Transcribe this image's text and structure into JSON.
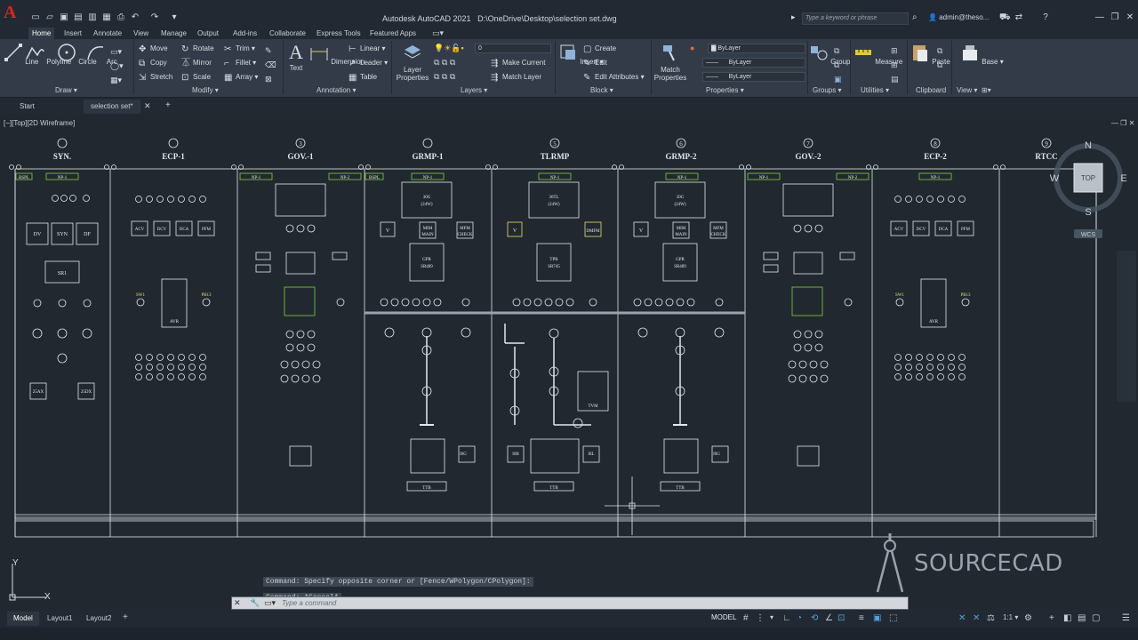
{
  "app": {
    "title": "Autodesk AutoCAD 2021",
    "file_path": "D:\\OneDrive\\Desktop\\selection set.dwg",
    "logo_letter": "A",
    "search_placeholder": "Type a keyword or phrase",
    "user": "admin@theso..."
  },
  "ribbon_tabs": [
    "Home",
    "Insert",
    "Annotate",
    "View",
    "Manage",
    "Output",
    "Add-ins",
    "Collaborate",
    "Express Tools",
    "Featured Apps"
  ],
  "ribbon": {
    "draw": {
      "label": "Draw",
      "tools": [
        "Line",
        "Polyline",
        "Circle",
        "Arc"
      ]
    },
    "modify": {
      "label": "Modify",
      "tools": [
        "Move",
        "Rotate",
        "Trim",
        "Copy",
        "Mirror",
        "Fillet",
        "Stretch",
        "Scale",
        "Array"
      ]
    },
    "annotation": {
      "label": "Annotation",
      "text": "Text",
      "dimension": "Dimension",
      "linear": "Linear",
      "leader": "Leader",
      "table": "Table"
    },
    "layers": {
      "label": "Layers",
      "layer_properties": "Layer Properties",
      "layer_value": "0",
      "make_current": "Make Current",
      "match_layer": "Match Layer"
    },
    "block": {
      "label": "Block",
      "insert": "Insert",
      "create": "Create",
      "edit": "Edit",
      "edit_attributes": "Edit Attributes"
    },
    "properties": {
      "label": "Properties",
      "match": "Match Properties",
      "color": "ByLayer",
      "linetype": "ByLayer",
      "lineweight": "ByLayer"
    },
    "groups": {
      "label": "Groups",
      "group": "Group"
    },
    "utilities": {
      "label": "Utilities",
      "measure": "Measure"
    },
    "clipboard": {
      "label": "Clipboard",
      "paste": "Paste"
    },
    "view": {
      "label": "View",
      "base": "Base"
    }
  },
  "file_tabs": {
    "start": "Start",
    "active": "selection set*"
  },
  "viewport_label": "[−][Top][2D Wireframe]",
  "panels": [
    {
      "num": "",
      "name": "SYN."
    },
    {
      "num": "",
      "name": "ECP-1"
    },
    {
      "num": "3",
      "name": "GOV.-1"
    },
    {
      "num": "",
      "name": "GRMP-1"
    },
    {
      "num": "5",
      "name": "TLRMP"
    },
    {
      "num": "6",
      "name": "GRMP-2"
    },
    {
      "num": "7",
      "name": "GOV.-2"
    },
    {
      "num": "8",
      "name": "ECP-2"
    },
    {
      "num": "9",
      "name": "RTCC"
    }
  ],
  "drawing_labels": {
    "bspl": "BSPL",
    "np1": "NP-1",
    "np2": "NP-2",
    "dv": "DV",
    "syn": "SYN",
    "df": "DF",
    "sr1": "SR1",
    "acv": "ACV",
    "dcv": "DCV",
    "dca": "DCA",
    "pfm": "PFM",
    "avr": "AVR",
    "25ax": "25AX",
    "25dx": "25DX",
    "sw1": "SW1",
    "pb13": "PB13",
    "30g": "30G",
    "24w": "(24W)",
    "30tl": "30TL",
    "gpr": "GPR",
    "sr489": "SR489",
    "tpr": "TPR",
    "sr745": "SR745",
    "v": "V",
    "mim": "MIM",
    "main": "MAIN",
    "mfm": "MFM",
    "check": "CHECK",
    "dmfm": "DMFM",
    "ttb": "TTB",
    "tvm": "TVM",
    "i0g": "I0G",
    "i0b": "I0B",
    "i0l": "I0L"
  },
  "viewcube": {
    "n": "N",
    "s": "S",
    "e": "E",
    "w": "W",
    "top": "TOP",
    "wcs": "WCS"
  },
  "command_history": [
    "Command: Specify opposite corner or [Fence/WPolygon/CPolygon]:",
    "Command: *Cancel*"
  ],
  "command_placeholder": "Type a command",
  "layout_tabs": [
    "Model",
    "Layout1",
    "Layout2"
  ],
  "status": {
    "model": "MODEL",
    "scale": "1:1"
  },
  "watermark": "SOURCECAD",
  "ucs": {
    "x": "X",
    "y": "Y"
  }
}
